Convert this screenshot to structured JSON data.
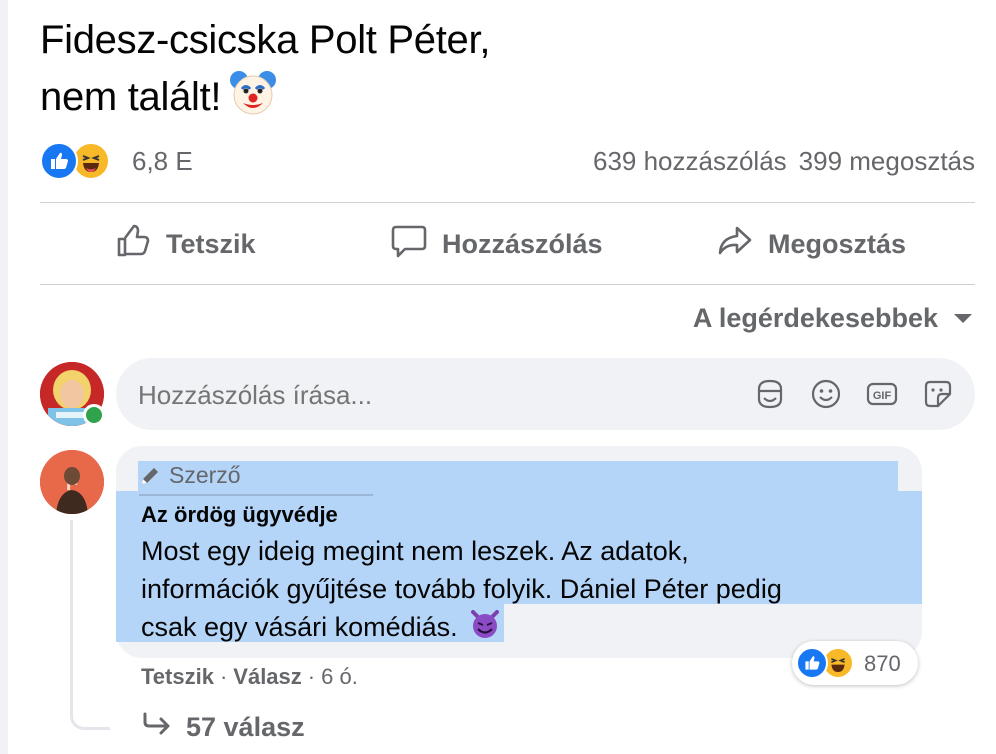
{
  "post": {
    "text_line1": "Fidesz-csicska Polt Péter,",
    "text_line2": "nem talált!",
    "emoji": "clown-face-emoji"
  },
  "reactions": {
    "icons": [
      "like-icon",
      "haha-icon"
    ],
    "count": "6,8 E",
    "comments": "639 hozzászólás",
    "shares": "399 megosztás"
  },
  "actions": {
    "like_label": "Tetszik",
    "comment_label": "Hozzászólás",
    "share_label": "Megosztás"
  },
  "sort": {
    "label": "A legérdekesebbek"
  },
  "composer": {
    "placeholder": "Hozzászólás írása...",
    "icons": [
      "avatar-sticker-icon",
      "emoji-icon",
      "gif-icon",
      "sticker-icon"
    ]
  },
  "comment": {
    "badge": "Szerző",
    "author": "Az ördög ügyvédje",
    "text_line1": "Most egy ideig megint nem leszek. Az adatok,",
    "text_line2": "információk gyűjtése tovább folyik. Dániel Péter pedig",
    "text_line3": "csak egy vásári komédiás.",
    "emoji": "smiling-devil-emoji",
    "like_label": "Tetszik",
    "reply_label": "Válasz",
    "time": "6 ó.",
    "separator": "·",
    "reaction_count": "870",
    "replies_label": "57 válasz"
  },
  "colors": {
    "muted_text": "#65676b",
    "bubble_bg": "#f0f2f5",
    "highlight": "#b4d4f8",
    "like_blue": "#1877f2",
    "haha_yellow": "#f7b928",
    "online_green": "#31a24c"
  }
}
